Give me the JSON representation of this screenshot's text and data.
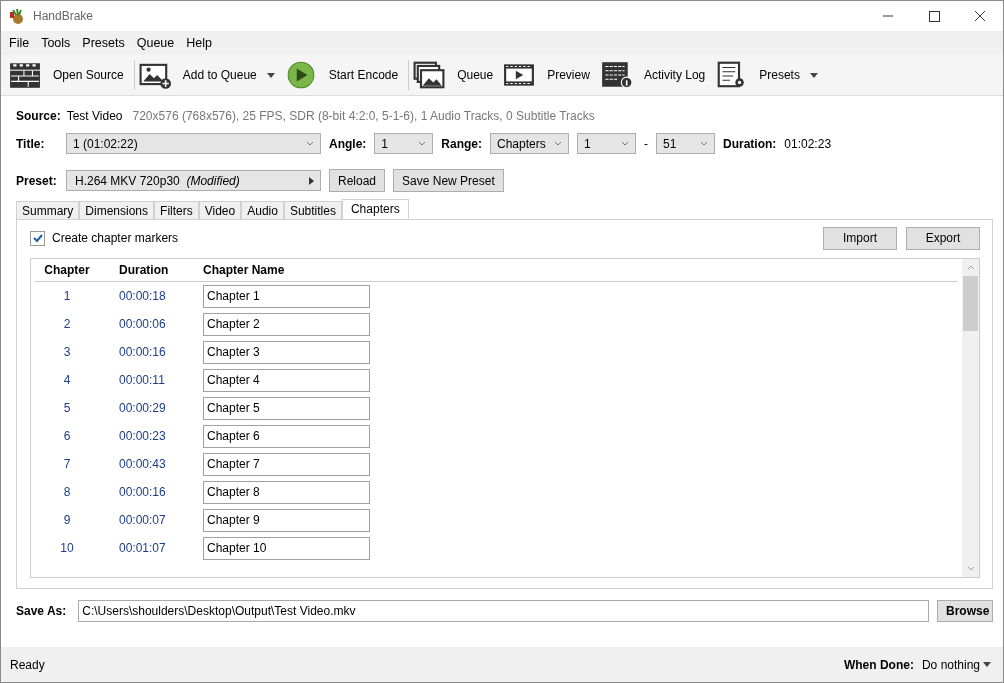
{
  "window": {
    "title": "HandBrake"
  },
  "menu": [
    "File",
    "Tools",
    "Presets",
    "Queue",
    "Help"
  ],
  "toolbar": [
    {
      "kind": "clapper",
      "label": "Open Source",
      "dropdown": false
    },
    {
      "kind": "add",
      "label": "Add to Queue",
      "dropdown": true
    },
    {
      "kind": "play",
      "label": "Start Encode",
      "dropdown": false
    },
    {
      "kind": "queue",
      "label": "Queue",
      "dropdown": false
    },
    {
      "kind": "film",
      "label": "Preview",
      "dropdown": false
    },
    {
      "kind": "log",
      "label": "Activity Log",
      "dropdown": false
    },
    {
      "kind": "presets",
      "label": "Presets",
      "dropdown": true
    }
  ],
  "source": {
    "label": "Source:",
    "name": "Test Video",
    "info": "720x576 (768x576), 25 FPS, SDR (8-bit 4:2:0, 5-1-6), 1 Audio Tracks, 0 Subtitle Tracks"
  },
  "title_row": {
    "title_label": "Title:",
    "title": "1  (01:02:22)",
    "angle_label": "Angle:",
    "angle": "1",
    "range_label": "Range:",
    "range": "Chapters",
    "from": "1",
    "dash": "-",
    "to": "51",
    "duration_label": "Duration:",
    "duration": "01:02:23"
  },
  "preset": {
    "label": "Preset:",
    "name": "H.264 MKV 720p30",
    "modifier": "(Modified)",
    "buttons": [
      "Reload",
      "Save New Preset"
    ]
  },
  "tabs": [
    {
      "label": "Summary",
      "selected": false
    },
    {
      "label": "Dimensions",
      "selected": false
    },
    {
      "label": "Filters",
      "selected": false
    },
    {
      "label": "Video",
      "selected": false
    },
    {
      "label": "Audio",
      "selected": false
    },
    {
      "label": "Subtitles",
      "selected": false
    },
    {
      "label": "Chapters",
      "selected": true
    }
  ],
  "chapters": {
    "create_markers": {
      "label": "Create chapter markers",
      "checked": true
    },
    "buttons": [
      "Import",
      "Export"
    ],
    "columns": [
      "Chapter",
      "Duration",
      "Chapter Name"
    ],
    "rows": [
      {
        "number": "1",
        "duration": "00:00:18",
        "name": "Chapter 1"
      },
      {
        "number": "2",
        "duration": "00:00:06",
        "name": "Chapter 2"
      },
      {
        "number": "3",
        "duration": "00:00:16",
        "name": "Chapter 3"
      },
      {
        "number": "4",
        "duration": "00:00:11",
        "name": "Chapter 4"
      },
      {
        "number": "5",
        "duration": "00:00:29",
        "name": "Chapter 5"
      },
      {
        "number": "6",
        "duration": "00:00:23",
        "name": "Chapter 6"
      },
      {
        "number": "7",
        "duration": "00:00:43",
        "name": "Chapter 7"
      },
      {
        "number": "8",
        "duration": "00:00:16",
        "name": "Chapter 8"
      },
      {
        "number": "9",
        "duration": "00:00:07",
        "name": "Chapter 9"
      },
      {
        "number": "10",
        "duration": "00:01:07",
        "name": "Chapter 10"
      }
    ]
  },
  "save_as": {
    "label": "Save As:",
    "path": "C:\\Users\\shoulders\\Desktop\\Output\\Test Video.mkv",
    "button": "Browse"
  },
  "status_bar": {
    "status": "Ready",
    "when_done_label": "When Done:",
    "when_done": "Do nothing"
  }
}
